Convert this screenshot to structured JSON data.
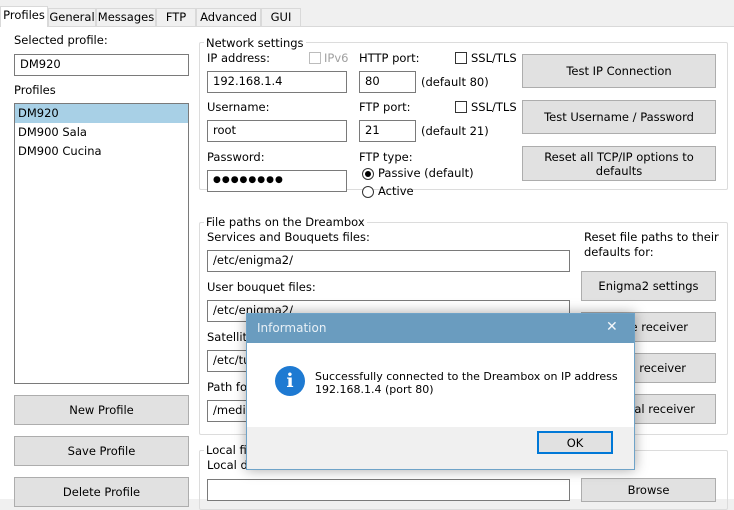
{
  "tabs": [
    "Profiles",
    "General",
    "Messages",
    "FTP",
    "Advanced",
    "GUI"
  ],
  "profiles": {
    "selected_label": "Selected profile:",
    "selected_value": "DM920",
    "list_label": "Profiles",
    "items": [
      "DM920",
      "DM900 Sala",
      "DM900 Cucina"
    ],
    "new_btn": "New Profile",
    "save_btn": "Save Profile",
    "delete_btn": "Delete Profile"
  },
  "network": {
    "legend": "Network settings",
    "ip_label": "IP address:",
    "ipv6_label": "IPv6",
    "ip_value": "192.168.1.4",
    "http_label": "HTTP port:",
    "http_value": "80",
    "http_default": "(default 80)",
    "ssl1_label": "SSL/TLS",
    "user_label": "Username:",
    "user_value": "root",
    "ftp_label": "FTP port:",
    "ftp_value": "21",
    "ftp_default": "(default 21)",
    "ssl2_label": "SSL/TLS",
    "pass_label": "Password:",
    "pass_value": "●●●●●●●●",
    "ftptype_label": "FTP type:",
    "passive_label": "Passive (default)",
    "active_label": "Active",
    "test_ip_btn": "Test IP Connection",
    "test_user_btn": "Test Username / Password",
    "reset_tcp_btn": "Reset all TCP/IP options to defaults"
  },
  "filepaths": {
    "legend": "File paths on the Dreambox",
    "services_label": "Services and Bouquets files:",
    "services_value": "/etc/enigma2/",
    "userbouquet_label": "User bouquet files:",
    "userbouquet_value": "/etc/enigma2/",
    "satellite_label": "Satellite",
    "satellite_value": "/etc/tu",
    "pathfor_label": "Path fo",
    "pathfor_value": "/media",
    "reset_label": "Reset file paths to their defaults for:",
    "enigma2_btn": "Enigma2 settings",
    "sat_btn": "ite receiver",
    "cable_btn": "e receiver",
    "terr_btn": "rial receiver"
  },
  "local": {
    "legend": "Local fi",
    "dir_label": "Local d",
    "browse_btn": "Browse"
  },
  "dialog": {
    "title": "Information",
    "message_line1": "Successfully connected to the Dreambox on IP address",
    "message_line2": "192.168.1.4 (port 80)",
    "ok_btn": "OK",
    "close_glyph": "✕",
    "icon_glyph": "i"
  }
}
